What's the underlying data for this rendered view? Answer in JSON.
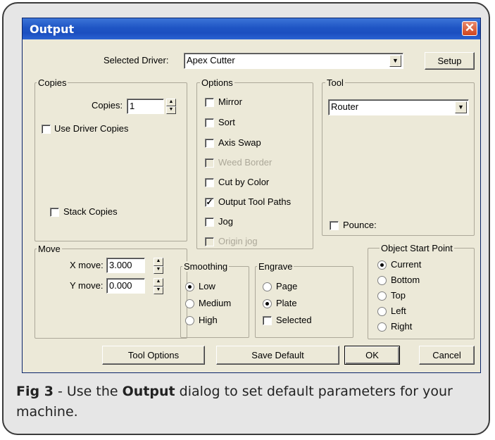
{
  "dialog": {
    "title": "Output",
    "close_glyph": "✕"
  },
  "driver": {
    "label": "Selected Driver:",
    "value": "Apex Cutter",
    "setup_button": "Setup"
  },
  "copies": {
    "legend": "Copies",
    "copies_label": "Copies:",
    "copies_value": "1",
    "use_driver_copies": "Use Driver Copies",
    "stack_copies": "Stack Copies"
  },
  "options": {
    "legend": "Options",
    "items": [
      {
        "label": "Mirror",
        "checked": false,
        "enabled": true
      },
      {
        "label": "Sort",
        "checked": false,
        "enabled": true
      },
      {
        "label": "Axis Swap",
        "checked": false,
        "enabled": true
      },
      {
        "label": "Weed Border",
        "checked": false,
        "enabled": false
      },
      {
        "label": "Cut by Color",
        "checked": false,
        "enabled": true
      },
      {
        "label": "Output Tool Paths",
        "checked": true,
        "enabled": true
      },
      {
        "label": "Jog",
        "checked": false,
        "enabled": true
      },
      {
        "label": "Origin jog",
        "checked": false,
        "enabled": false
      }
    ]
  },
  "tool": {
    "legend": "Tool",
    "value": "Router",
    "pounce_label": "Pounce:"
  },
  "move": {
    "legend": "Move",
    "x_label": "X move:",
    "x_value": "3.000",
    "y_label": "Y move:",
    "y_value": "0.000"
  },
  "smoothing": {
    "legend": "Smoothing",
    "options": [
      "Low",
      "Medium",
      "High"
    ],
    "selected": "Low"
  },
  "engrave": {
    "legend": "Engrave",
    "options": [
      "Page",
      "Plate"
    ],
    "selected": "Plate",
    "selected_checkbox": "Selected"
  },
  "start_point": {
    "legend": "Object Start Point",
    "options": [
      "Current",
      "Bottom",
      "Top",
      "Left",
      "Right"
    ],
    "selected": "Current"
  },
  "buttons": {
    "tool_options": "Tool Options",
    "save_default": "Save Default",
    "ok": "OK",
    "cancel": "Cancel"
  },
  "caption": {
    "fig": "Fig 3",
    "text_before": " - Use the ",
    "bold_word": "Output",
    "text_after": " dialog to set default parameters for your machine."
  }
}
